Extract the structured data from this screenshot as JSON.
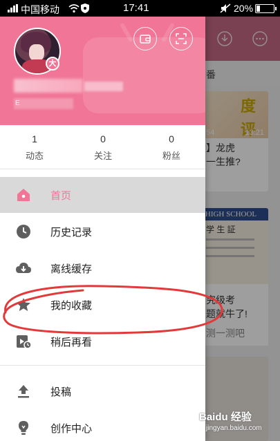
{
  "status_bar": {
    "carrier": "中国移动",
    "time": "17:41",
    "battery": "20%"
  },
  "background_app": {
    "tab_label": "番",
    "card1": {
      "thumb_text_top": "度",
      "thumb_text_bottom": "评",
      "duration_left": "54",
      "duration_right": "13:21",
      "caption_1": "】龙虎",
      "caption_2": "一生推?"
    },
    "card2": {
      "thumb_text_top": "HIGH SCHOOL",
      "thumb_text_bottom": "学 生 証",
      "caption_1": "究级考",
      "caption_2": "题就牛了!",
      "caption_3": "测一测吧"
    }
  },
  "drawer": {
    "user": {
      "level_badge": "大",
      "uid_prefix": "E"
    },
    "stats": [
      {
        "value": "1",
        "label": "动态"
      },
      {
        "value": "0",
        "label": "关注"
      },
      {
        "value": "0",
        "label": "粉丝"
      }
    ],
    "menu": [
      {
        "label": "首页",
        "icon": "home-icon",
        "active": true
      },
      {
        "label": "历史记录",
        "icon": "clock-icon",
        "active": false
      },
      {
        "label": "离线缓存",
        "icon": "cloud-download-icon",
        "active": false
      },
      {
        "label": "我的收藏",
        "icon": "star-icon",
        "active": false
      },
      {
        "label": "稍后再看",
        "icon": "watch-later-icon",
        "active": false
      },
      {
        "label": "投稿",
        "icon": "upload-icon",
        "active": false
      },
      {
        "label": "创作中心",
        "icon": "lightbulb-icon",
        "active": false
      }
    ]
  },
  "watermark": {
    "text": "Baidu 经验",
    "sub": "jingyan.baidu.com"
  },
  "colors": {
    "accent": "#f07596",
    "annotation": "#e23a3a",
    "status_bar": "#000000"
  }
}
